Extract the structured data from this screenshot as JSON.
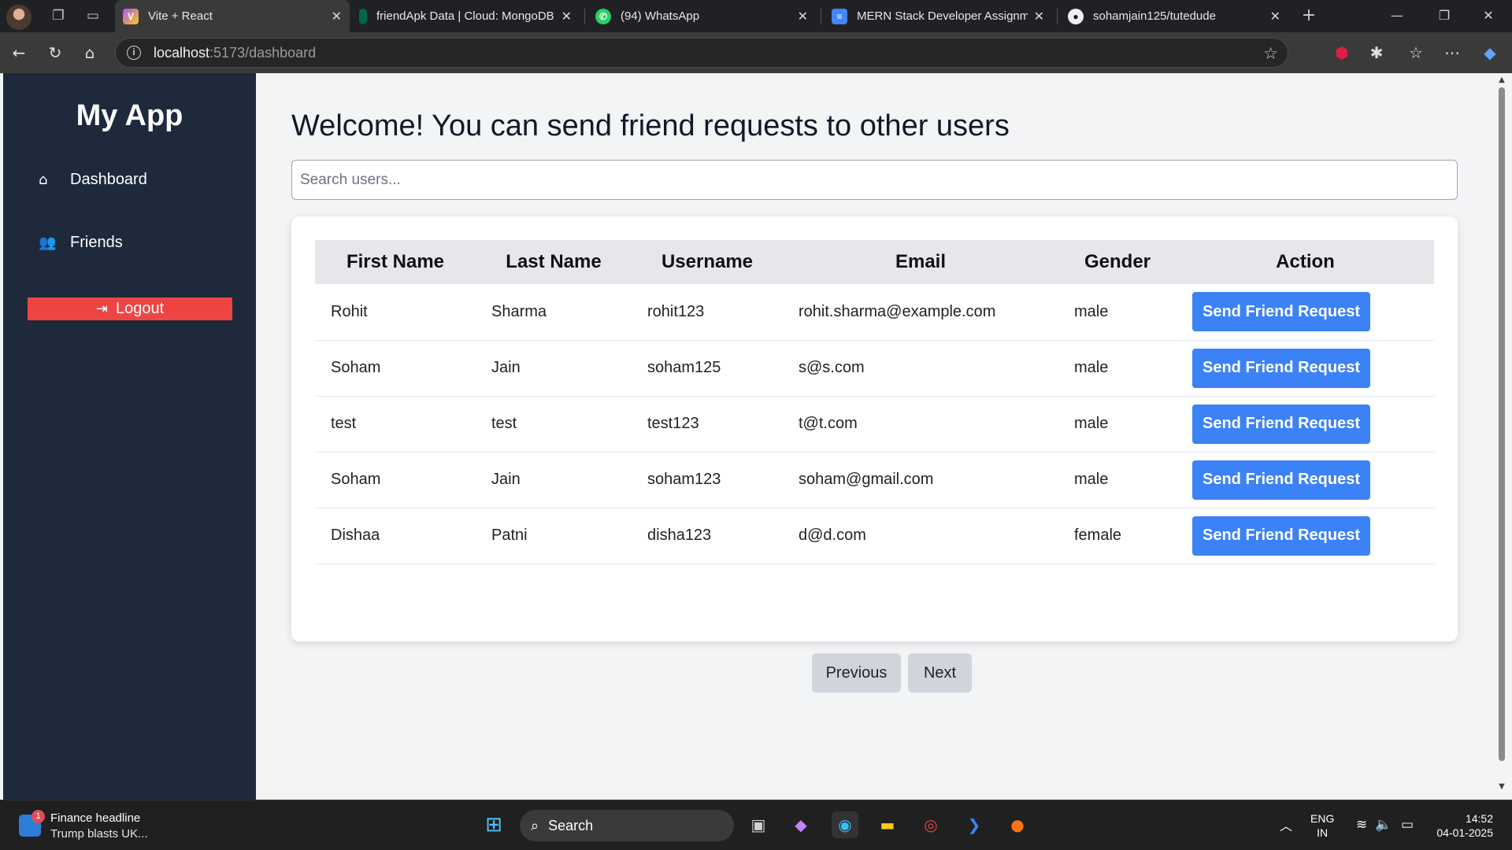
{
  "browser": {
    "tabs": [
      {
        "title": "Vite + React",
        "active": true,
        "favicon_icon": "vite-icon"
      },
      {
        "title": "friendApk Data | Cloud: MongoDB",
        "active": false,
        "favicon_icon": "mongodb-leaf-icon"
      },
      {
        "title": "(94) WhatsApp",
        "active": false,
        "favicon_icon": "whatsapp-icon"
      },
      {
        "title": "MERN Stack Developer Assignment",
        "active": false,
        "favicon_icon": "google-docs-icon"
      },
      {
        "title": "sohamjain125/tutedude",
        "active": false,
        "favicon_icon": "github-icon"
      }
    ],
    "address": {
      "host": "localhost",
      "path": ":5173/dashboard"
    }
  },
  "sidebar": {
    "app_title": "My App",
    "items": [
      {
        "label": "Dashboard",
        "icon": "home-icon"
      },
      {
        "label": "Friends",
        "icon": "users-icon"
      }
    ],
    "logout_label": "Logout"
  },
  "main": {
    "heading": "Welcome! You can send friend requests to other users",
    "search_placeholder": "Search users...",
    "table": {
      "headers": [
        "First Name",
        "Last Name",
        "Username",
        "Email",
        "Gender",
        "Action"
      ],
      "rows": [
        {
          "first": "Rohit",
          "last": "Sharma",
          "username": "rohit123",
          "email": "rohit.sharma@example.com",
          "gender": "male",
          "action": "Send Friend Request"
        },
        {
          "first": "Soham",
          "last": "Jain",
          "username": "soham125",
          "email": "s@s.com",
          "gender": "male",
          "action": "Send Friend Request"
        },
        {
          "first": "test",
          "last": "test",
          "username": "test123",
          "email": "t@t.com",
          "gender": "male",
          "action": "Send Friend Request"
        },
        {
          "first": "Soham",
          "last": "Jain",
          "username": "soham123",
          "email": "soham@gmail.com",
          "gender": "male",
          "action": "Send Friend Request"
        },
        {
          "first": "Dishaa",
          "last": "Patni",
          "username": "disha123",
          "email": "d@d.com",
          "gender": "female",
          "action": "Send Friend Request"
        }
      ]
    },
    "pagination": {
      "previous": "Previous",
      "next": "Next"
    }
  },
  "taskbar": {
    "news_title": "Finance headline",
    "news_subtitle": "Trump blasts UK...",
    "news_badge": "1",
    "search_label": "Search",
    "language": "ENG",
    "region": "IN",
    "time": "14:52",
    "date": "04-01-2025"
  },
  "colors": {
    "sidebar_bg": "#1e293b",
    "logout_bg": "#ef4444",
    "primary_button": "#3b82f6",
    "pager_button": "#d1d5db"
  }
}
